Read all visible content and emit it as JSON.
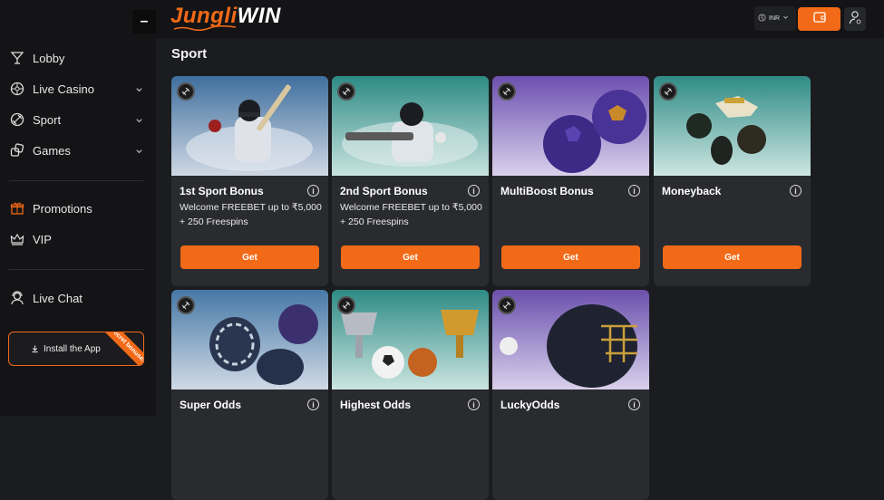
{
  "header": {
    "logo_part1": "Jungli",
    "logo_part2": "WIN",
    "currency": "INR"
  },
  "sidebar": {
    "collapse_label": "–",
    "items": [
      {
        "label": "Lobby",
        "icon": "cocktail-icon"
      },
      {
        "label": "Live Casino",
        "icon": "roulette-icon"
      },
      {
        "label": "Sport",
        "icon": "ball-icon"
      },
      {
        "label": "Games",
        "icon": "dice-icon"
      },
      {
        "label": "Promotions",
        "icon": "gift-icon"
      },
      {
        "label": "VIP",
        "icon": "crown-icon"
      },
      {
        "label": "Live Chat",
        "icon": "headset-icon"
      }
    ],
    "install_label": "Install the App",
    "install_ribbon": "Secret bonuses"
  },
  "main": {
    "section_title": "Sport",
    "cards": [
      {
        "title": "1st Sport Bonus",
        "desc": "Welcome FREEBET up to ₹5,000 + 250 Freespins",
        "button": "Get",
        "theme": "#4a7fa8"
      },
      {
        "title": "2nd Sport Bonus",
        "desc": "Welcome FREEBET up to ₹5,000 + 250 Freespins",
        "button": "Get",
        "theme": "#2e8c86"
      },
      {
        "title": "MultiBoost Bonus",
        "desc": "",
        "button": "Get",
        "theme": "#6b4fa8"
      },
      {
        "title": "Moneyback",
        "desc": "",
        "button": "Get",
        "theme": "#2e8c86"
      },
      {
        "title": "Super Odds",
        "desc": "",
        "button": "",
        "theme": "#4a7fa8"
      },
      {
        "title": "Highest Odds",
        "desc": "",
        "button": "",
        "theme": "#2e8c86"
      },
      {
        "title": "LuckyOdds",
        "desc": "",
        "button": "",
        "theme": "#6b4fa8"
      }
    ]
  },
  "colors": {
    "accent": "#f26a17",
    "sidebar_bg": "#141416",
    "card_bg": "#2a2b2f"
  }
}
